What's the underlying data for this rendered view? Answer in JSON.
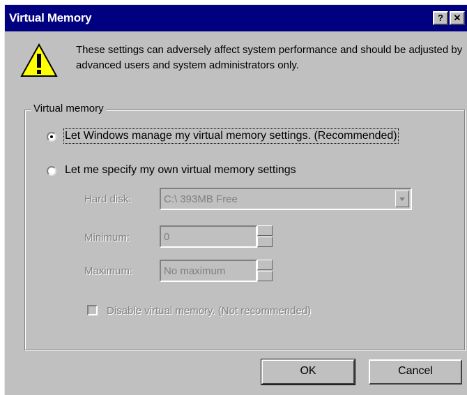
{
  "window": {
    "title": "Virtual Memory",
    "help_button": "?",
    "close_button": "✕"
  },
  "warning": {
    "icon": "warning-icon",
    "text": "These settings can adversely affect system performance and should be adjusted by advanced users and system administrators only."
  },
  "virtual_memory": {
    "group_label": "Virtual memory",
    "option_windows": {
      "label": "Let Windows manage my virtual memory settings. (Recommended)",
      "selected": true
    },
    "option_custom": {
      "label": "Let me specify my own virtual memory settings",
      "selected": false
    },
    "hard_disk": {
      "label": "Hard disk:",
      "value": "C:\\ 393MB Free"
    },
    "minimum": {
      "label": "Minimum:",
      "value": "0"
    },
    "maximum": {
      "label": "Maximum:",
      "value": "No maximum"
    },
    "disable": {
      "label": "Disable virtual memory. (Not recommended)",
      "checked": false
    }
  },
  "buttons": {
    "ok": "OK",
    "cancel": "Cancel"
  },
  "colors": {
    "titlebar": "#000080",
    "face": "#c0c0c0",
    "disabled_text": "#808080"
  }
}
